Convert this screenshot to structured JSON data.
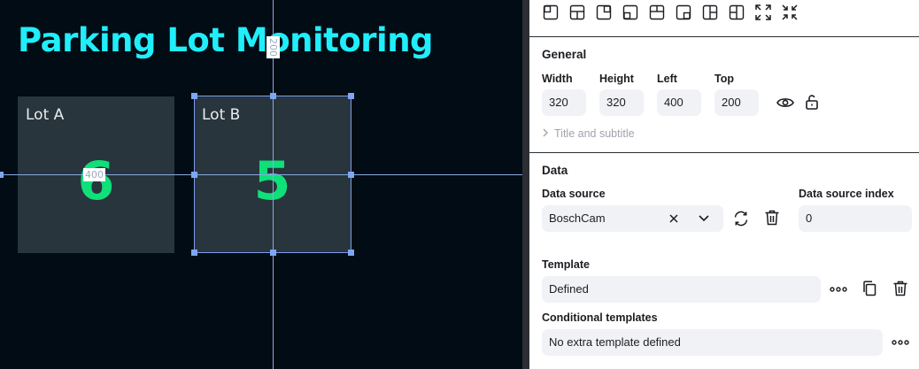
{
  "canvas": {
    "title": "Parking Lot Monitoring",
    "lots": [
      {
        "label": "Lot A",
        "count": "6"
      },
      {
        "label": "Lot B",
        "count": "5"
      }
    ],
    "dim_left": "400",
    "dim_top": "200"
  },
  "panel": {
    "layout_icons": [
      "align-top-left-icon",
      "align-top-center-icon",
      "align-top-right-icon",
      "align-bottom-left-icon",
      "align-center-icon",
      "align-bottom-right-icon",
      "align-middle-left-icon",
      "align-middle-right-icon",
      "expand-icon",
      "shrink-icon"
    ],
    "general": {
      "title": "General",
      "width_label": "Width",
      "height_label": "Height",
      "left_label": "Left",
      "top_label": "Top",
      "width": "320",
      "height": "320",
      "left": "400",
      "top": "200",
      "title_subtitle": "Title and subtitle"
    },
    "data": {
      "title": "Data",
      "source_label": "Data source",
      "source_value": "BoschCam",
      "index_label": "Data source index",
      "index_value": "0",
      "template_label": "Template",
      "template_value": "Defined",
      "conditional_label": "Conditional templates",
      "conditional_value": "No extra template defined"
    },
    "colors": {
      "accent_title": "#20eefb",
      "count_green": "#0fe07a",
      "selection": "#7b9ef0"
    }
  }
}
